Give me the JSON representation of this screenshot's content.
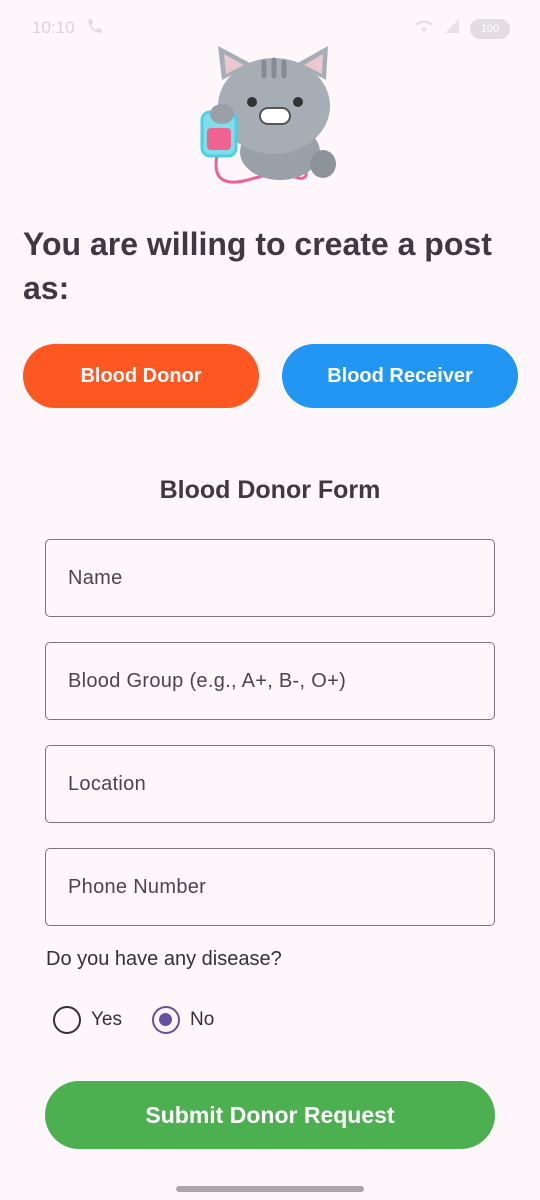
{
  "status_bar": {
    "time": "10:10",
    "battery": "100"
  },
  "header": {
    "prompt": "You are willing to create a post as:"
  },
  "roles": {
    "donor_label": "Blood Donor",
    "receiver_label": "Blood Receiver",
    "donor_color": "#FF5722",
    "receiver_color": "#2196F3"
  },
  "form": {
    "title": "Blood Donor Form",
    "fields": {
      "name_placeholder": "Name",
      "blood_group_placeholder": "Blood Group (e.g., A+, B-, O+)",
      "location_placeholder": "Location",
      "phone_placeholder": "Phone Number"
    },
    "disease_question": "Do you have any disease?",
    "options": {
      "yes_label": "Yes",
      "no_label": "No",
      "selected": "No"
    },
    "submit_label": "Submit Donor Request",
    "submit_color": "#4CAF50"
  },
  "icons": {
    "mascot": "cat-holding-blood-bag-icon",
    "phone": "phone-call-icon",
    "wifi": "wifi-icon",
    "signal": "signal-icon"
  }
}
